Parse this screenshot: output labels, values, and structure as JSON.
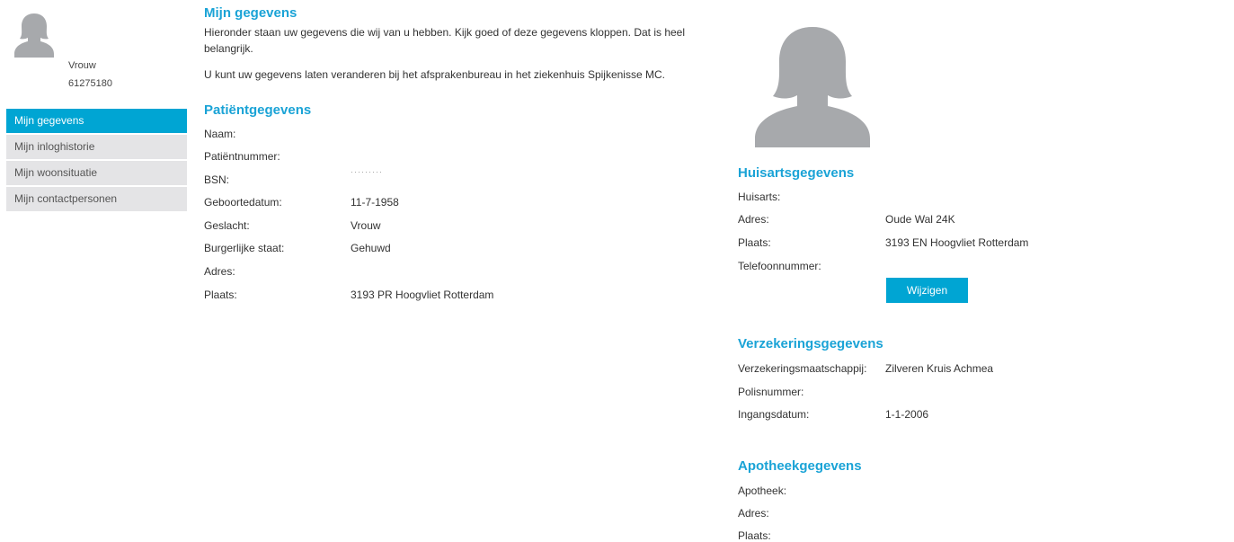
{
  "profile": {
    "gender": "Vrouw",
    "id": "61275180"
  },
  "sidebar": {
    "items": [
      {
        "label": "Mijn gegevens",
        "active": true
      },
      {
        "label": "Mijn inloghistorie",
        "active": false
      },
      {
        "label": "Mijn woonsituatie",
        "active": false
      },
      {
        "label": "Mijn contactpersonen",
        "active": false
      }
    ]
  },
  "main": {
    "title": "Mijn gegevens",
    "intro_line1": "Hieronder staan uw gegevens die wij van u hebben. Kijk goed of deze gegevens kloppen. Dat is heel",
    "intro_line2": "belangrijk.",
    "intro2": "U kunt uw gegevens laten veranderen bij het afsprakenbureau in het ziekenhuis Spijkenisse MC.",
    "patient": {
      "title": "Patiëntgegevens",
      "rows": [
        {
          "label": "Naam:",
          "value": ""
        },
        {
          "label": "Patiëntnummer:",
          "value": ""
        },
        {
          "label": "BSN:",
          "value": "·········"
        },
        {
          "label": "Geboortedatum:",
          "value": "11-7-1958"
        },
        {
          "label": "Geslacht:",
          "value": "Vrouw"
        },
        {
          "label": "Burgerlijke staat:",
          "value": "Gehuwd"
        },
        {
          "label": "Adres:",
          "value": ""
        },
        {
          "label": "Plaats:",
          "value": "3193 PR  Hoogvliet Rotterdam"
        }
      ]
    }
  },
  "right": {
    "gp": {
      "title": "Huisartsgegevens",
      "rows": [
        {
          "label": "Huisarts:",
          "value": ""
        },
        {
          "label": "Adres:",
          "value": "Oude Wal 24K"
        },
        {
          "label": "Plaats:",
          "value": "3193 EN  Hoogvliet Rotterdam"
        },
        {
          "label": "Telefoonnummer:",
          "value": ""
        }
      ],
      "button": "Wijzigen"
    },
    "insurance": {
      "title": "Verzekeringsgegevens",
      "rows": [
        {
          "label": "Verzekeringsmaatschappij:",
          "value": "Zilveren Kruis Achmea"
        },
        {
          "label": "Polisnummer:",
          "value": ""
        },
        {
          "label": "Ingangsdatum:",
          "value": "1-1-2006"
        }
      ]
    },
    "pharmacy": {
      "title": "Apotheekgegevens",
      "rows": [
        {
          "label": "Apotheek:",
          "value": ""
        },
        {
          "label": "Adres:",
          "value": ""
        },
        {
          "label": "Plaats:",
          "value": ""
        }
      ]
    }
  },
  "icons": {
    "avatar": "user-female-silhouette-icon"
  },
  "colors": {
    "accent": "#00a5d3",
    "heading": "#1aa3d6",
    "nav_bg": "#e4e4e6",
    "avatar": "#a7a9ac"
  }
}
